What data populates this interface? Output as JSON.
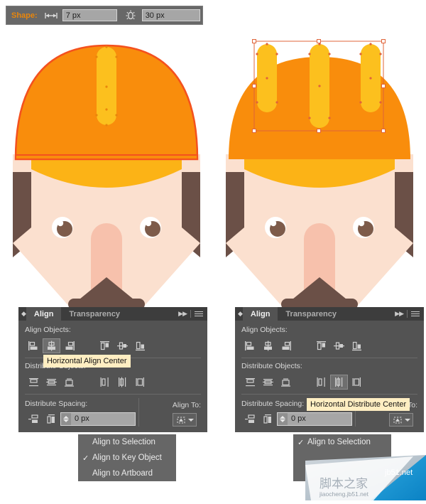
{
  "toolbar": {
    "shape_label": "Shape:",
    "width_icon": "width-arrows-icon",
    "width_value": "7 px",
    "corner_icon": "corner-radius-icon",
    "corner_value": "30 px"
  },
  "panels": [
    {
      "id": "left",
      "tabs": [
        {
          "label": "Align",
          "active": true
        },
        {
          "label": "Transparency",
          "active": false
        }
      ],
      "collapse_icon": "double-arrow-icon",
      "menu_icon": "panel-menu-icon",
      "align_objects_label": "Align Objects:",
      "align_objects_buttons": [
        {
          "name": "horizontal-align-left",
          "selected": false
        },
        {
          "name": "horizontal-align-center",
          "selected": true
        },
        {
          "name": "horizontal-align-right",
          "selected": false
        },
        {
          "name": "vertical-align-top",
          "selected": false
        },
        {
          "name": "vertical-align-middle",
          "selected": false
        },
        {
          "name": "vertical-align-bottom",
          "selected": false
        }
      ],
      "distribute_objects_label": "Distribute Objects:",
      "distribute_objects_buttons": [
        {
          "name": "vertical-distribute-top",
          "selected": false
        },
        {
          "name": "vertical-distribute-center",
          "selected": false
        },
        {
          "name": "vertical-distribute-bottom",
          "selected": false
        },
        {
          "name": "horizontal-distribute-left",
          "selected": false
        },
        {
          "name": "horizontal-distribute-center",
          "selected": false
        },
        {
          "name": "horizontal-distribute-right",
          "selected": false
        }
      ],
      "distribute_spacing_label": "Distribute Spacing:",
      "distribute_spacing_buttons": [
        {
          "name": "vertical-distribute-spacing",
          "selected": false
        },
        {
          "name": "horizontal-distribute-spacing",
          "selected": false
        }
      ],
      "spacing_value": "0 px",
      "align_to_label": "Align To:",
      "align_to_icon": "align-to-selection-icon",
      "tooltip": "Horizontal Align Center",
      "dropdown": [
        {
          "label": "Align to Selection",
          "checked": false,
          "highlighted": false
        },
        {
          "label": "Align to Key Object",
          "checked": true,
          "highlighted": false
        },
        {
          "label": "Align to Artboard",
          "checked": false,
          "highlighted": false
        }
      ]
    },
    {
      "id": "right",
      "tabs": [
        {
          "label": "Align",
          "active": true
        },
        {
          "label": "Transparency",
          "active": false
        }
      ],
      "collapse_icon": "double-arrow-icon",
      "menu_icon": "panel-menu-icon",
      "align_objects_label": "Align Objects:",
      "align_objects_buttons": [
        {
          "name": "horizontal-align-left",
          "selected": false
        },
        {
          "name": "horizontal-align-center",
          "selected": false
        },
        {
          "name": "horizontal-align-right",
          "selected": false
        },
        {
          "name": "vertical-align-top",
          "selected": false
        },
        {
          "name": "vertical-align-middle",
          "selected": false
        },
        {
          "name": "vertical-align-bottom",
          "selected": false
        }
      ],
      "distribute_objects_label": "Distribute Objects:",
      "distribute_objects_buttons": [
        {
          "name": "vertical-distribute-top",
          "selected": false
        },
        {
          "name": "vertical-distribute-center",
          "selected": false
        },
        {
          "name": "vertical-distribute-bottom",
          "selected": false
        },
        {
          "name": "horizontal-distribute-left",
          "selected": false
        },
        {
          "name": "horizontal-distribute-center",
          "selected": true
        },
        {
          "name": "horizontal-distribute-right",
          "selected": false
        }
      ],
      "distribute_spacing_label": "Distribute Spacing:",
      "distribute_spacing_buttons": [
        {
          "name": "vertical-distribute-spacing",
          "selected": false
        },
        {
          "name": "horizontal-distribute-spacing",
          "selected": false
        }
      ],
      "spacing_value": "0 px",
      "align_to_label": "Align To:",
      "align_to_icon": "align-to-selection-icon",
      "tooltip": "Horizontal Distribute Center",
      "dropdown": [
        {
          "label": "Align to Selection",
          "checked": true,
          "highlighted": false
        }
      ]
    }
  ],
  "artwork": {
    "left": {
      "description": "construction worker with orange hard hat, one centered yellow ridge stripe",
      "stripe_count": 1,
      "selected": false
    },
    "right": {
      "description": "construction worker with orange hard hat, three yellow ridge stripes with selection bounding box",
      "stripe_count": 3,
      "selected": true
    },
    "colors": {
      "hat_orange": "#f98d0c",
      "hat_stroke": "#f4511e",
      "brim_yellow": "#fcb316",
      "stripe_yellow": "#fcc01e",
      "skin": "#fbe0cf",
      "skin_shadow": "#f7cdb5",
      "hair_brown": "#6b5047",
      "nose_pink": "#f7c1ac",
      "eye_white": "#ffffff",
      "iris_brown": "#7d5b4a",
      "selection_blue": "#e0643a"
    }
  },
  "watermark": {
    "site": "jb51.net",
    "cn_text": "脚本之家",
    "url": "jiaocheng.jb51.net"
  }
}
